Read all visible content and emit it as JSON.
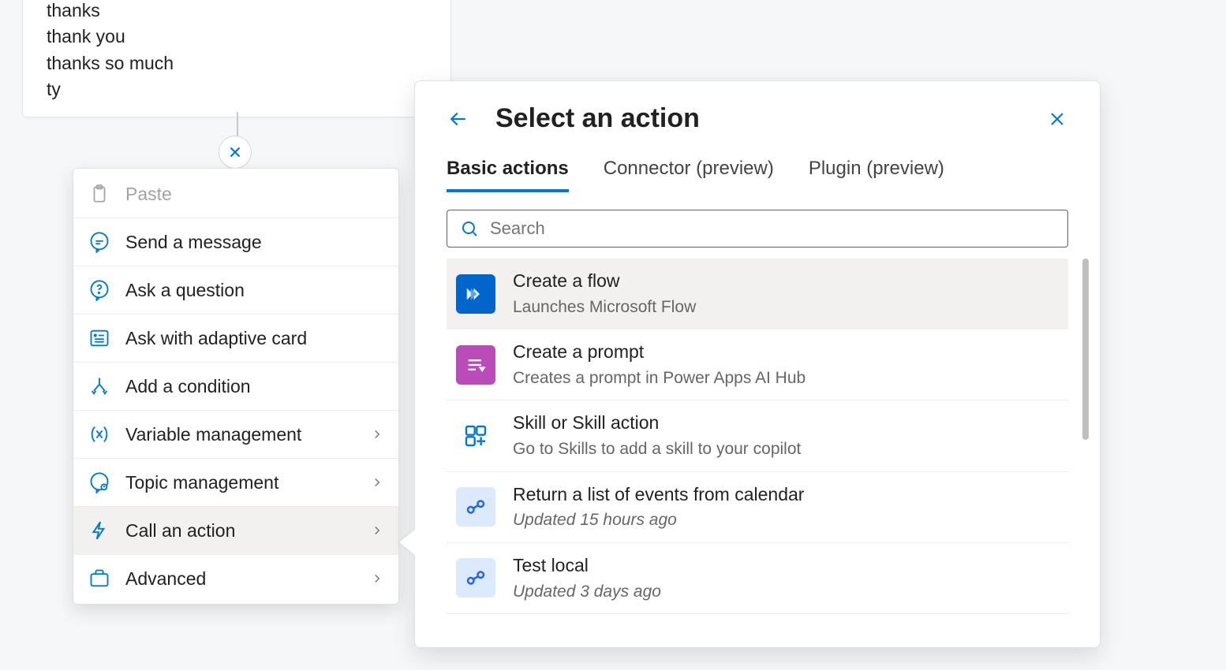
{
  "trigger": {
    "phrases": [
      "thanks",
      "thank you",
      "thanks so much",
      "ty"
    ]
  },
  "menu": {
    "paste": "Paste",
    "send_message": "Send a message",
    "ask_question": "Ask a question",
    "ask_adaptive": "Ask with adaptive card",
    "add_condition": "Add a condition",
    "variable_mgmt": "Variable management",
    "topic_mgmt": "Topic management",
    "call_action": "Call an action",
    "advanced": "Advanced"
  },
  "panel": {
    "title": "Select an action",
    "tabs": {
      "basic": "Basic actions",
      "connector": "Connector (preview)",
      "plugin": "Plugin (preview)"
    },
    "search_placeholder": "Search",
    "actions": [
      {
        "title": "Create a flow",
        "sub": "Launches Microsoft Flow",
        "icon": "flow"
      },
      {
        "title": "Create a prompt",
        "sub": "Creates a prompt in Power Apps AI Hub",
        "icon": "prompt"
      },
      {
        "title": "Skill or Skill action",
        "sub": "Go to Skills to add a skill to your copilot",
        "icon": "skill"
      },
      {
        "title": "Return a list of events from calendar",
        "sub": "Updated 15 hours ago",
        "icon": "oo",
        "italic": true
      },
      {
        "title": "Test local",
        "sub": "Updated 3 days ago",
        "icon": "oo",
        "italic": true
      }
    ]
  }
}
